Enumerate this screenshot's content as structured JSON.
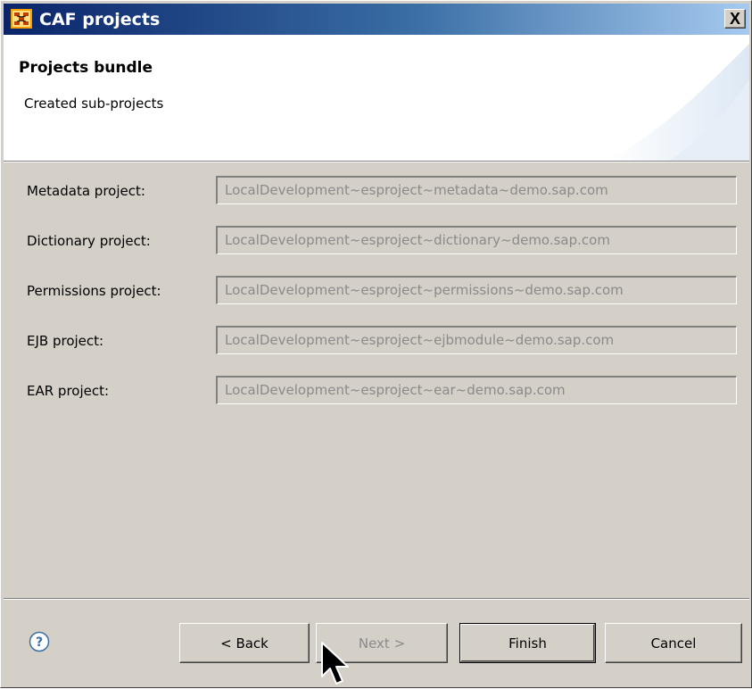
{
  "window": {
    "title": "CAF projects",
    "close_label": "X"
  },
  "header": {
    "title": "Projects bundle",
    "description": "Created sub-projects"
  },
  "form": {
    "rows": [
      {
        "label": "Metadata project:",
        "value": "LocalDevelopment~esproject~metadata~demo.sap.com"
      },
      {
        "label": "Dictionary project:",
        "value": "LocalDevelopment~esproject~dictionary~demo.sap.com"
      },
      {
        "label": "Permissions project:",
        "value": "LocalDevelopment~esproject~permissions~demo.sap.com"
      },
      {
        "label": "EJB project:",
        "value": "LocalDevelopment~esproject~ejbmodule~demo.sap.com"
      },
      {
        "label": "EAR project:",
        "value": "LocalDevelopment~esproject~ear~demo.sap.com"
      }
    ]
  },
  "footer": {
    "help_icon": "help-icon",
    "back_label": "< Back",
    "next_label": "Next >",
    "finish_label": "Finish",
    "cancel_label": "Cancel"
  },
  "colors": {
    "titlebar_start": "#0a246a",
    "titlebar_end": "#a6caf0",
    "dialog_bg": "#d4d0c8",
    "disabled_text": "#8a8a8a",
    "help_icon": "#3a6ea5"
  }
}
